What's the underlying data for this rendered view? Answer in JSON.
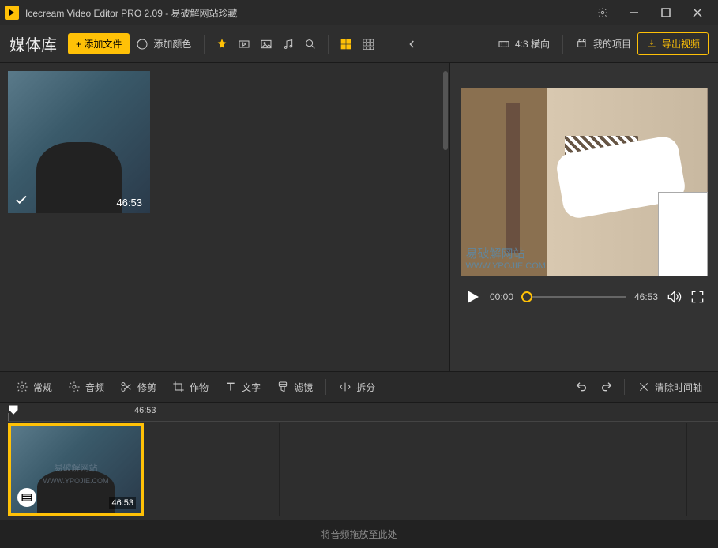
{
  "title": "Icecream Video Editor PRO 2.09  - 易破解网站珍藏",
  "toolbar": {
    "library_label": "媒体库",
    "add_file_label": "+ 添加文件",
    "add_color_label": "添加颜色",
    "aspect_label": "4:3 横向",
    "projects_label": "我的项目",
    "export_label": "导出视频"
  },
  "media": {
    "items": [
      {
        "duration": "46:53",
        "checked": true
      }
    ]
  },
  "watermark": {
    "text": "易破解网站",
    "url": "WWW.YPOJIE.COM"
  },
  "preview": {
    "current_time": "00:00",
    "total_time": "46:53"
  },
  "edit_toolbar": {
    "general": "常规",
    "audio": "音频",
    "trim": "修剪",
    "crop": "作物",
    "text": "文字",
    "filter": "滤镜",
    "split": "拆分",
    "clear_timeline": "清除时间轴"
  },
  "timeline": {
    "ruler_time": "46:53",
    "clips": [
      {
        "duration": "46:53"
      }
    ],
    "audio_placeholder": "将音频拖放至此处"
  }
}
